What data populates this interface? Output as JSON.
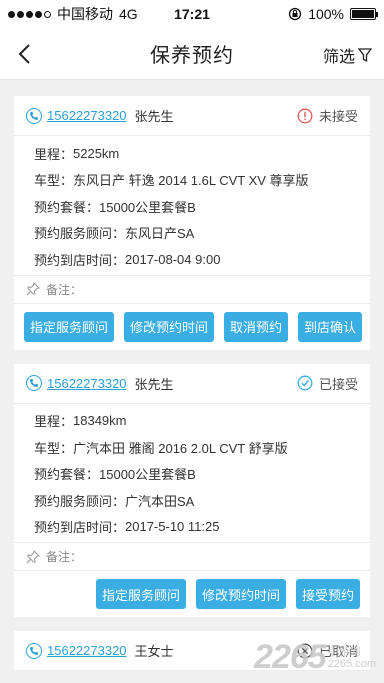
{
  "statusbar": {
    "carrier": "中国移动",
    "network": "4G",
    "time": "17:21",
    "battery": "100%"
  },
  "navbar": {
    "title": "保养预约",
    "filter_label": "筛选"
  },
  "labels": {
    "mileage": "里程：",
    "car": "车型：",
    "package": "预约套餐：",
    "advisor": "预约服务顾问：",
    "time": "预约到店时间：",
    "remark": "备注："
  },
  "orders": [
    {
      "phone": "15622273320",
      "name": "张先生",
      "status": "未接受",
      "mileage": "5225km",
      "car": "东风日产 轩逸 2014 1.6L CVT XV 尊享版",
      "package": "15000公里套餐B",
      "advisor": "东风日产SA",
      "time": "2017-08-04 9:00",
      "actions": [
        "指定服务顾问",
        "修改预约时间",
        "取消预约",
        "到店确认"
      ]
    },
    {
      "phone": "15622273320",
      "name": "张先生",
      "status": "已接受",
      "mileage": "18349km",
      "car": "广汽本田 雅阁 2016 2.0L CVT 舒享版",
      "package": "15000公里套餐B",
      "advisor": "广汽本田SA",
      "time": "2017-5-10 11:25",
      "actions": [
        "指定服务顾问",
        "修改预约时间",
        "接受预约"
      ]
    },
    {
      "phone": "15622273320",
      "name": "王女士",
      "status": "已取消"
    }
  ],
  "watermark": {
    "number": "2265",
    "line1": "手游网",
    "line2": "2265.com"
  },
  "colors": {
    "accent": "#3aaee3",
    "link": "#2a9fd8",
    "warn": "#e05a5a",
    "ok": "#3aaee3"
  }
}
